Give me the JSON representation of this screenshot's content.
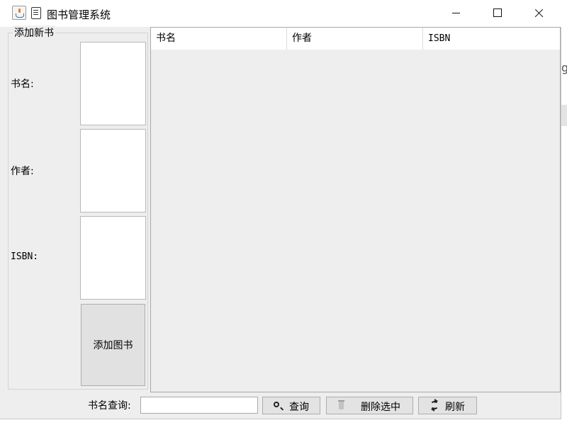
{
  "window": {
    "title": "图书管理系统"
  },
  "background": {
    "edge_char": "g"
  },
  "add_panel": {
    "legend": "添加新书",
    "fields": [
      {
        "label": "书名:",
        "value": ""
      },
      {
        "label": "作者:",
        "value": ""
      },
      {
        "label": "ISBN:",
        "value": ""
      }
    ],
    "add_button_label": "添加图书"
  },
  "table": {
    "columns": [
      "书名",
      "作者",
      "ISBN"
    ],
    "rows": []
  },
  "bottom_bar": {
    "search_label": "书名查询:",
    "search_value": "",
    "query_button_label": "查询",
    "delete_button_label": "删除选中",
    "refresh_button_label": "刷新"
  },
  "icons": {
    "app": "java-cup-icon",
    "title": "book-stack-icon",
    "query": "search-icon",
    "delete": "trash-icon",
    "refresh": "refresh-icon"
  }
}
